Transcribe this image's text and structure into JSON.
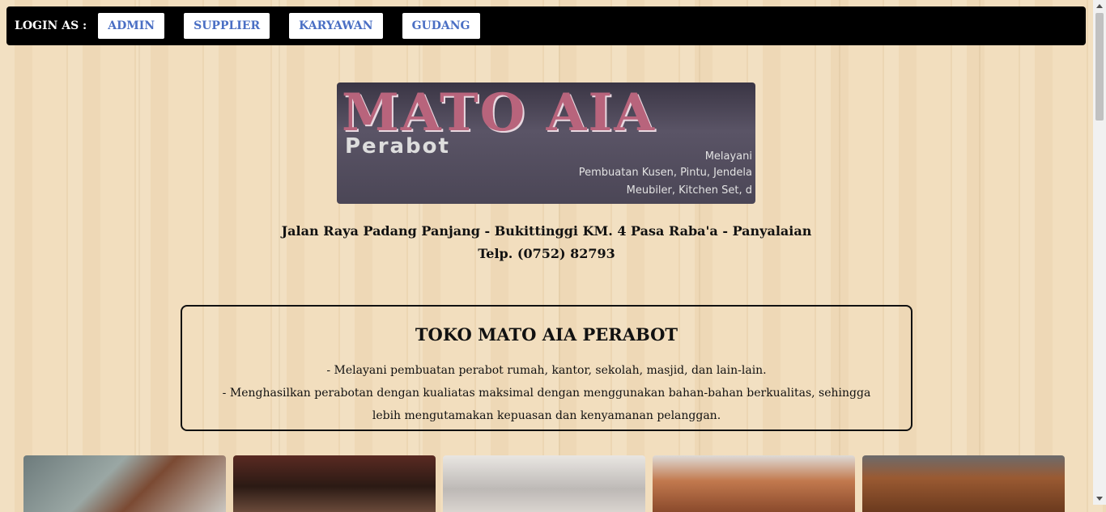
{
  "nav": {
    "login_label": "LOGIN AS :",
    "buttons": [
      "ADMIN",
      "SUPPLIER",
      "KARYAWAN",
      "GUDANG"
    ]
  },
  "banner": {
    "title": "MATO AIA",
    "subtitle": "Perabot",
    "line1": "Melayani",
    "line2": "Pembuatan Kusen, Pintu, Jendela",
    "line3": "Meubiler, Kitchen Set, d"
  },
  "address": {
    "line1": "Jalan Raya Padang Panjang - Bukittinggi KM. 4 Pasa Raba'a - Panyalaian",
    "line2": "Telp. (0752) 82793"
  },
  "info": {
    "title": "TOKO MATO AIA PERABOT",
    "line1": "- Melayani pembuatan perabot rumah, kantor, sekolah, masjid, dan lain-lain.",
    "line2": "- Menghasilkan perabotan dengan kualiatas maksimal dengan menggunakan bahan-bahan berkualitas, sehingga lebih mengutamakan kepuasan dan kenyamanan pelanggan."
  }
}
